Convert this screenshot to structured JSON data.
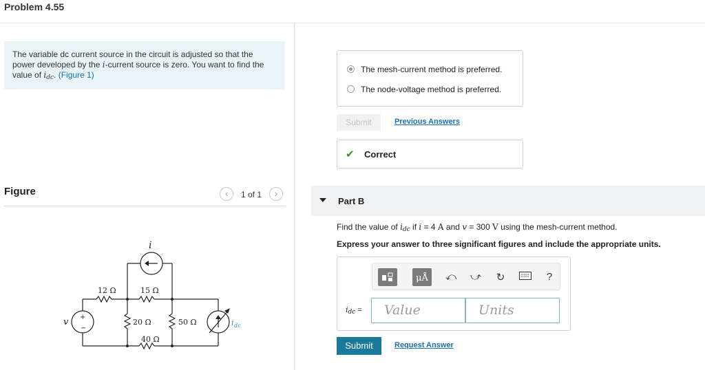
{
  "problem": {
    "title": "Problem 4.55"
  },
  "intro": {
    "text_1": "The variable dc current source in the circuit is adjusted so that the power developed by the ",
    "i_var": "i",
    "text_2": "-current source is zero. You want to find the value of ",
    "idc_var": "i",
    "idc_sub": "dc",
    "text_3": ". ",
    "figure_link": "(Figure 1)"
  },
  "figure": {
    "header": "Figure",
    "count": "1 of 1",
    "prev_icon": "chevron-left-icon",
    "next_icon": "chevron-right-icon",
    "labels": {
      "i": "i",
      "r12": "12 Ω",
      "r15": "15 Ω",
      "r20": "20 Ω",
      "r50": "50 Ω",
      "r40": "40 Ω",
      "v": "v",
      "plus": "+",
      "minus": "−",
      "idc": "i",
      "idc_sub": "dc"
    }
  },
  "part_a": {
    "options": [
      {
        "label": "The mesh-current method is preferred.",
        "selected": true
      },
      {
        "label": "The node-voltage method is preferred.",
        "selected": false
      }
    ],
    "submit_label": "Submit",
    "previous_answers": "Previous Answers",
    "result_icon": "checkmark-icon",
    "result_text": "Correct"
  },
  "part_b": {
    "title": "Part B",
    "question": {
      "prefix": "Find the value of ",
      "idc_var": "i",
      "idc_sub": "dc",
      "mid1": " if ",
      "i_var": "i",
      "mid2": " = 4 ",
      "unit_a": "A",
      "mid3": " and ",
      "v_var": "v",
      "mid4": " = 300 ",
      "unit_v": "V",
      "suffix": " using the mesh-current method."
    },
    "instruction": "Express your answer to three significant figures and include the appropriate units.",
    "answer_label_var": "i",
    "answer_label_sub": "dc",
    "answer_label_eq": " =",
    "value_placeholder": "Value",
    "units_placeholder": "Units",
    "toolbar": {
      "units_btn": "μÅ",
      "undo_icon": "undo-icon",
      "redo_icon": "redo-icon",
      "reset_icon": "reset-icon",
      "keyboard_icon": "keyboard-icon",
      "help": "?"
    },
    "submit_label": "Submit",
    "request_answer": "Request Answer"
  },
  "colors": {
    "intro_bg": "#e8f4f6",
    "link": "#1a6fb0",
    "submit_bg": "#1a7a9c",
    "correct_check": "#3a8a2a",
    "field_border": "#7fb6c9"
  }
}
